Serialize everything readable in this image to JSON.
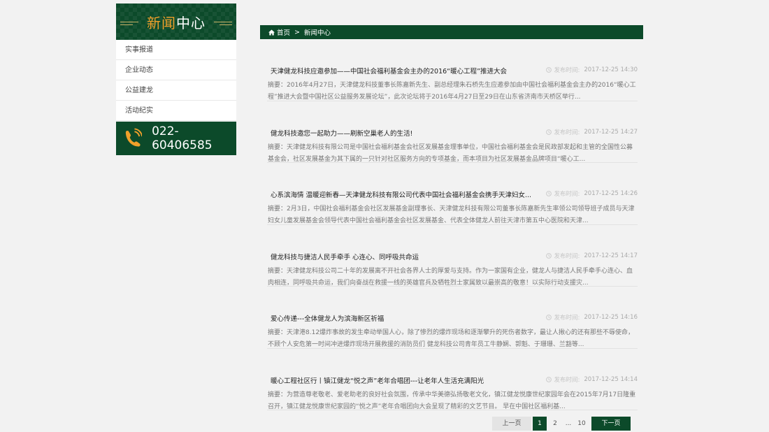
{
  "sidebar": {
    "title_a": "新闻",
    "title_b": "中心",
    "items": [
      {
        "label": "实事报道"
      },
      {
        "label": "企业动态"
      },
      {
        "label": "公益建龙"
      },
      {
        "label": "活动纪实"
      }
    ],
    "phone": "022-60406585"
  },
  "breadcrumb": {
    "home": "首页",
    "sep": ">",
    "current": "新闻中心"
  },
  "time_label": "发布时间:",
  "news": [
    {
      "title": "天津健龙科技应邀参加——中国社会福利基金会主办的2016“暖心工程”推进大会",
      "time": "2017-12-25 14:30",
      "desc": "摘要：2016年4月27日，天津健龙科技董事长陈嘉新先生、副总经理朱石桥先生应邀参加由中国社会福利基金会主办的2016“暖心工程”推进大会暨中国社区公益服务发展论坛”，此次论坛将于2016年4月27日至29日在山东省济南市天桥区举行..."
    },
    {
      "title": "健龙科技邀您一起助力——刷新空巢老人的生活!",
      "time": "2017-12-25 14:27",
      "desc": "摘要：天津健龙科技有限公司是中国社会福利基金会社区发展基金理事单位，中国社会福利基金会是民政部发起和主管的全国性公募基金会，社区发展基金为其下属的一只针对社区服务方向的专项基金，而本项目为社区发展基金品牌项目“暖心工..."
    },
    {
      "title": "心系滨海情 温暖迎新春—天津健龙科技有限公司代表中国社会福利基金会携手天津妇女...",
      "time": "2017-12-25 14:26",
      "desc": "摘要：2月3日，中国社会福利基金会社区发展基金副理事长、天津健龙科技有限公司董事长陈嘉新先生率领公司领导班子成员与天津妇女儿童发展基金会领导代表中国社会福利基金会社区发展基金、代表全体健龙人前往天津市第五中心医院和天津..."
    },
    {
      "title": "健龙科技与捷洁人民手牵手 心连心、同呼吸共命运",
      "time": "2017-12-25 14:17",
      "desc": "摘要：天津健龙科技公司二十年的发展离不开社会各界人士的厚爱与支持。作为一家国有企业，健龙人与捷洁人民手牵手心连心、血肉相连，同呼吸共命运，我们向奋战在救援一线的英雄官兵及牺牲烈士家属致以最崇高的敬意！以实际行动支援灾..."
    },
    {
      "title": "爱心传递---全体健龙人为滨海新区祈福",
      "time": "2017-12-25 14:16",
      "desc": "摘要：天津港8.12爆炸事故的发生牵动举国人心，除了惨烈的爆炸现场和逐渐攀升的死伤者数字，最让人揪心的还有那些不辱使命，不顾个人安危第一时间冲进爆炸现场开展救援的消防员们 健龙科技公司青年员工牛静娴、郭魁、于珊珊、兰豁等..."
    },
    {
      "title": "暖心工程社区行丨镇江健龙“悦之声”老年合唱团---让老年人生活充满阳光",
      "time": "2017-12-25 14:14",
      "desc": "摘要：为营造尊老敬老、爱老助老的良好社会氛围，传承中华美德弘扬敬老文化，镇江健龙悦康世纪家园年会在2015年7月17日隆重召开，镇江健龙悦康世纪家园的“悦之声”老年合唱团向大会呈现了精彩的文艺节目。 早在中国社区福利基..."
    }
  ],
  "pager": {
    "prev": "上一页",
    "current": "1",
    "p2": "2",
    "dots": "...",
    "last": "10",
    "next": "下一页"
  },
  "colors": {
    "brand_green": "#0c4a2a",
    "accent_orange": "#f0a02a"
  }
}
